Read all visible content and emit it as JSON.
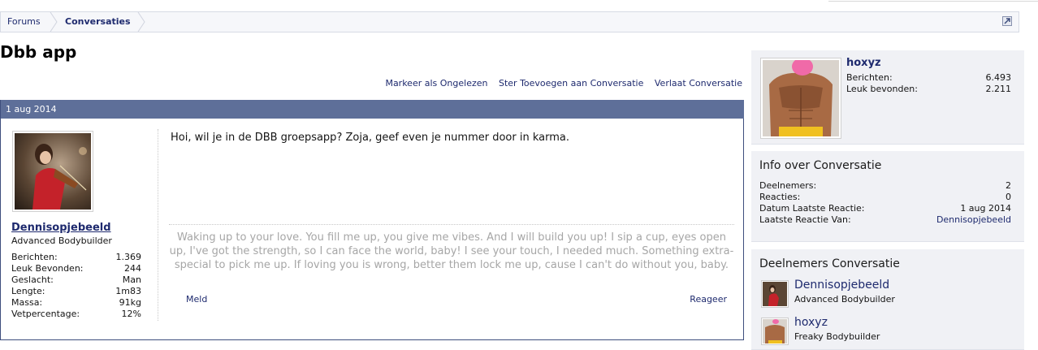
{
  "breadcrumb": {
    "items": [
      "Forums",
      "Conversaties"
    ]
  },
  "page": {
    "title": "Dbb app"
  },
  "actions": {
    "mark_unread": "Markeer als Ongelezen",
    "star": "Ster Toevoegen aan Conversatie",
    "leave": "Verlaat Conversatie"
  },
  "message": {
    "date": "1 aug 2014",
    "author": {
      "name": "Dennisopjebeeld",
      "title": "Advanced Bodybuilder",
      "stats": [
        {
          "label": "Berichten:",
          "value": "1.369"
        },
        {
          "label": "Leuk Bevonden:",
          "value": "244"
        },
        {
          "label": "Geslacht:",
          "value": "Man"
        },
        {
          "label": "Lengte:",
          "value": "1m83"
        },
        {
          "label": "Massa:",
          "value": "91kg"
        },
        {
          "label": "Vetpercentage:",
          "value": "12%"
        }
      ]
    },
    "body": "Hoi, wil je in de DBB groepsapp? Zoja, geef even je nummer door in karma.",
    "signature": "Waking up to your love. You fill me up, you give me vibes. And I will build you up! I sip a cup, eyes open up, I've got the strength, so I can face the world, baby! I see your touch, I needed much. Something extra-special to pick me up. If loving you is wrong, better them lock me up, cause I can't do without you, baby.",
    "report": "Meld",
    "reply": "Reageer"
  },
  "sidebar": {
    "profile": {
      "name": "hoxyz",
      "stats": [
        {
          "label": "Berichten:",
          "value": "6.493"
        },
        {
          "label": "Leuk bevonden:",
          "value": "2.211"
        }
      ]
    },
    "info": {
      "heading": "Info over Conversatie",
      "rows": [
        {
          "label": "Deelnemers:",
          "value": "2"
        },
        {
          "label": "Reacties:",
          "value": "0"
        },
        {
          "label": "Datum Laatste Reactie:",
          "value": "1 aug 2014"
        },
        {
          "label": "Laatste Reactie Van:",
          "value": "Dennisopjebeeld"
        }
      ]
    },
    "participants": {
      "heading": "Deelnemers Conversatie",
      "list": [
        {
          "name": "Dennisopjebeeld",
          "title": "Advanced Bodybuilder"
        },
        {
          "name": "hoxyz",
          "title": "Freaky Bodybuilder"
        }
      ]
    }
  },
  "colors": {
    "link": "#1e2a6e",
    "header_bar": "#5e6f99",
    "panel_bg": "#f0f1f5",
    "signature": "#a6a6a6"
  }
}
